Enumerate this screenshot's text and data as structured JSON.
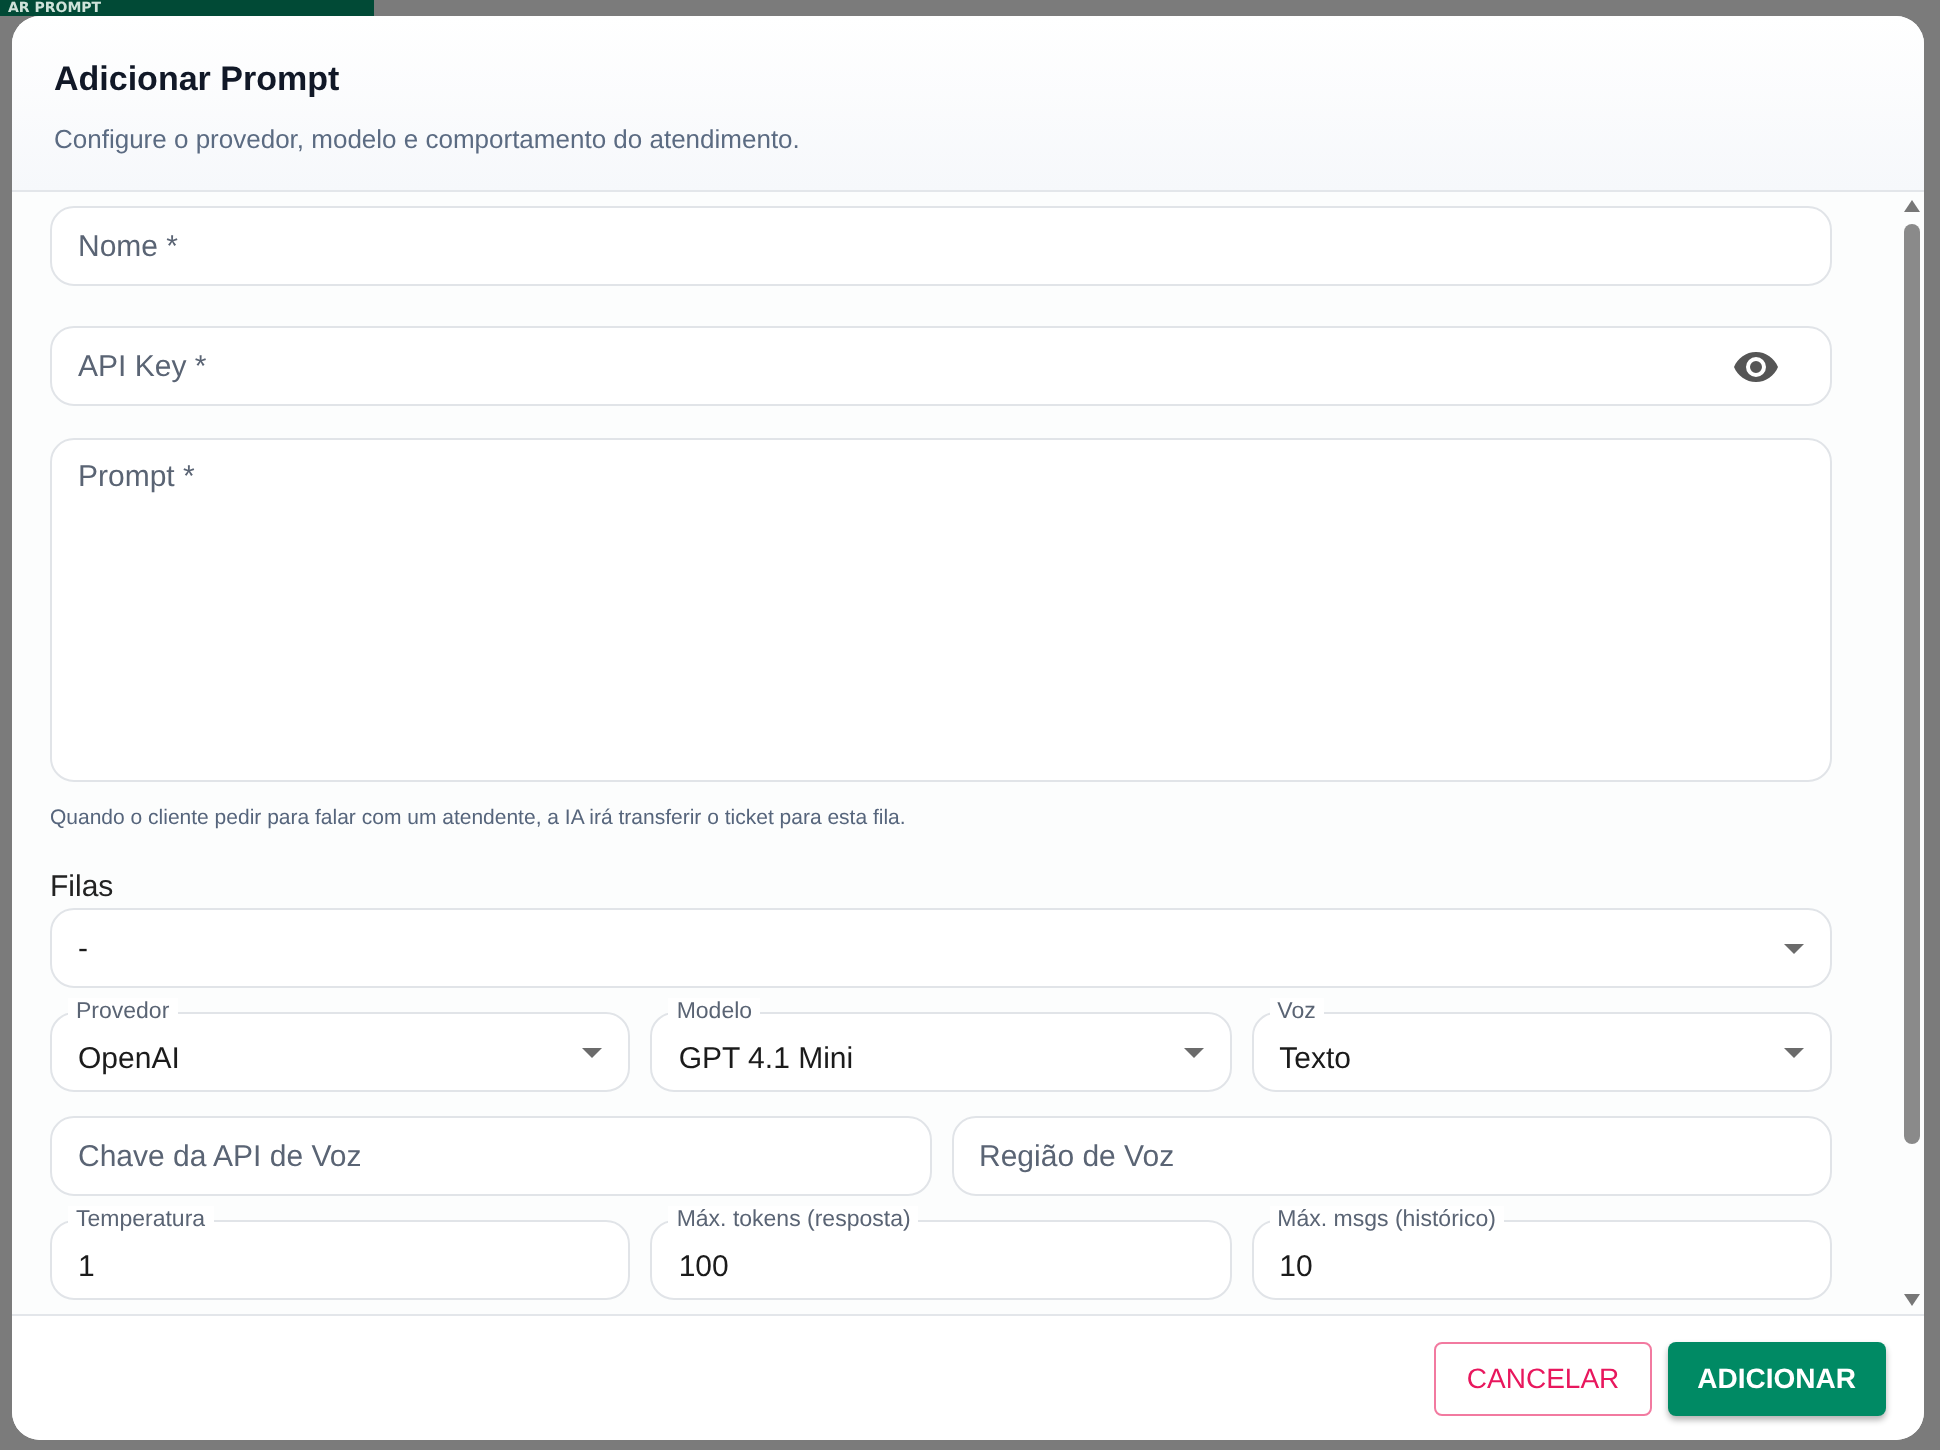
{
  "backdrop_button": "AR PROMPT",
  "dialog": {
    "title": "Adicionar Prompt",
    "subtitle": "Configure o provedor, modelo e comportamento do atendimento."
  },
  "name_field": {
    "placeholder": "Nome *"
  },
  "api_key_field": {
    "placeholder": "API Key *"
  },
  "prompt_field": {
    "placeholder": "Prompt *"
  },
  "helper_text": "Quando o cliente pedir para falar com um atendente, a IA irá transferir o ticket para esta fila.",
  "queues": {
    "label": "Filas",
    "value": "-"
  },
  "selects": [
    {
      "label": "Provedor",
      "value": "OpenAI"
    },
    {
      "label": "Modelo",
      "value": "GPT 4.1 Mini"
    },
    {
      "label": "Voz",
      "value": "Texto"
    }
  ],
  "voice_fields": [
    {
      "placeholder": "Chave da API de Voz"
    },
    {
      "placeholder": "Região de Voz"
    }
  ],
  "number_fields": [
    {
      "label": "Temperatura",
      "value": "1"
    },
    {
      "label": "Máx. tokens (resposta)",
      "value": "100"
    },
    {
      "label": "Máx. msgs (histórico)",
      "value": "10"
    }
  ],
  "buttons": [
    {
      "label": "CANCELAR",
      "kind": "outlined"
    },
    {
      "label": "ADICIONAR",
      "kind": "filled"
    }
  ]
}
